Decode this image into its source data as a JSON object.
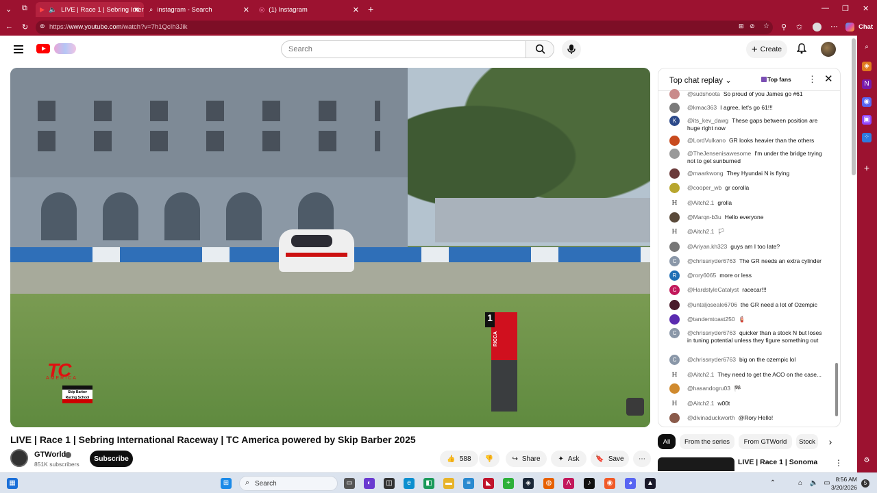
{
  "browser": {
    "tabs": [
      {
        "title": "LIVE | Race 1 | Sebring Interna"
      },
      {
        "title": "instagram - Search"
      },
      {
        "title": "(1) Instagram"
      }
    ],
    "url_prefix": "https://",
    "url_domain": "www.youtube.com",
    "url_path": "/watch?v=7h1QcIh3Jik",
    "chat_label": "Chat"
  },
  "header": {
    "search_placeholder": "Search",
    "create_label": "Create"
  },
  "video": {
    "marker_label": "RICCA",
    "marker_number": "1",
    "tc_logo": "TC",
    "tc_sub": "AMERICA",
    "skip_logo": "Skip Barber Racing School"
  },
  "info": {
    "title": "LIVE | Race 1 | Sebring International Raceway | TC America powered by Skip Barber 2025",
    "channel": "GTWorld",
    "subscribers": "851K subscribers",
    "subscribe_label": "Subscribe",
    "likes": "588",
    "share_label": "Share",
    "ask_label": "Ask",
    "save_label": "Save"
  },
  "chat": {
    "title": "Top chat replay",
    "top_fans_label": "Top fans",
    "messages": [
      {
        "author": "@sudshoota",
        "text": "So proud of you James go #61",
        "avatar": "",
        "color": "#c98a8a"
      },
      {
        "author": "@kmac363",
        "text": "I agree, let's go 61!!!",
        "avatar": "",
        "color": "#7a7a7a"
      },
      {
        "author": "@its_kev_dawg",
        "text": "These gaps between position are huge right now",
        "avatar": "K",
        "color": "#2d4a8a"
      },
      {
        "author": "@LordVulkano",
        "text": "GR looks heavier than the others",
        "avatar": "",
        "color": "#c84a1e"
      },
      {
        "author": "@TheJensenisawesome",
        "text": "I'm under the bridge trying not to get sunburned",
        "avatar": "",
        "color": "#999"
      },
      {
        "author": "@maarkwong",
        "text": "They Hyundai N is flying",
        "avatar": "",
        "color": "#6b3a3a"
      },
      {
        "author": "@cooper_wb",
        "text": "gr corolla",
        "avatar": "",
        "color": "#b8a62e"
      },
      {
        "author": "@Aitch2.1",
        "text": "grolla",
        "avatar": "H",
        "color": "#ffffff"
      },
      {
        "author": "@Marqn-b3u",
        "text": "Hello everyone",
        "avatar": "",
        "color": "#5a4a3a"
      },
      {
        "author": "@Aitch2.1",
        "text": "🏳",
        "avatar": "H",
        "color": "#ffffff"
      },
      {
        "author": "@Ariyan.kh323",
        "text": "guys am I too late?",
        "avatar": "",
        "color": "#777"
      },
      {
        "author": "@chrissnyder6763",
        "text": "The GR needs an extra cylinder",
        "avatar": "C",
        "color": "#8a97a8"
      },
      {
        "author": "@rory6065",
        "text": "more or less",
        "avatar": "R",
        "color": "#1f6fb5"
      },
      {
        "author": "@HardstyleCatalyst",
        "text": "racecar!!!",
        "avatar": "C",
        "color": "#c2185b"
      },
      {
        "author": "@untaljoseale6706",
        "text": "the GR need a lot of Ozempic",
        "avatar": "",
        "color": "#4a1a2a"
      },
      {
        "author": "@tandemtoast250",
        "text": "🧯",
        "avatar": "",
        "color": "#5a2bb0"
      },
      {
        "author": "@chrissnyder6763",
        "text": "quicker than a stock N but loses in tuning potential unless they figure something out",
        "avatar": "C",
        "color": "#8a97a8"
      },
      {
        "author": "@chrissnyder6763",
        "text": "big on the ozempic lol",
        "avatar": "C",
        "color": "#8a97a8"
      },
      {
        "author": "@Aitch2.1",
        "text": "They need to get the ACO on the case...",
        "avatar": "H",
        "color": "#ffffff"
      },
      {
        "author": "@hasandogru03",
        "text": "🏁",
        "avatar": "",
        "color": "#d08a2e"
      },
      {
        "author": "@Aitch2.1",
        "text": "w00t",
        "avatar": "H",
        "color": "#ffffff"
      },
      {
        "author": "@divinaduckworth",
        "text": "@Rory Hello!",
        "avatar": "",
        "color": "#8a5a4a"
      }
    ]
  },
  "chips": [
    "All",
    "From the series",
    "From GTWorld",
    "Stock"
  ],
  "recommendation": {
    "title": "LIVE | Race 1 | Sonoma"
  },
  "taskbar": {
    "search_label": "Search",
    "time": "8:56 AM",
    "date": "3/20/2026",
    "notif_count": "5"
  },
  "colors": {
    "browser_chrome": "#9c1230",
    "yt_red": "#ff0000",
    "subscribe_bg": "#0f0f0f"
  }
}
